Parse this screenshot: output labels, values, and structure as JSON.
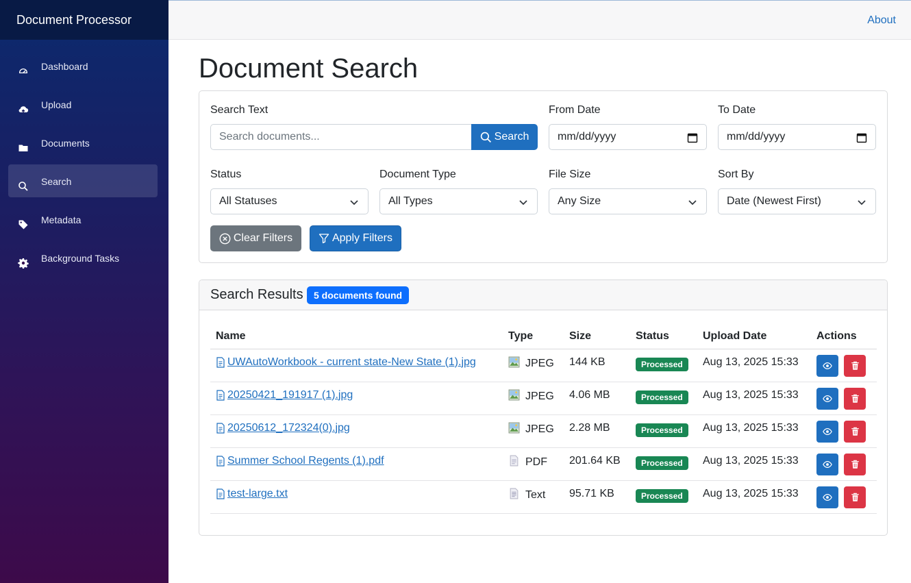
{
  "app": {
    "brand": "Document Processor"
  },
  "sidebar": {
    "items": [
      {
        "label": "Dashboard",
        "icon": "speedometer-icon",
        "active": false
      },
      {
        "label": "Upload",
        "icon": "cloud-upload-icon",
        "active": false
      },
      {
        "label": "Documents",
        "icon": "folder-icon",
        "active": false
      },
      {
        "label": "Search",
        "icon": "search-icon",
        "active": true
      },
      {
        "label": "Metadata",
        "icon": "tag-icon",
        "active": false
      },
      {
        "label": "Background Tasks",
        "icon": "gear-icon",
        "active": false
      }
    ]
  },
  "topbar": {
    "about_label": "About"
  },
  "page": {
    "title": "Document Search"
  },
  "filters": {
    "search_text_label": "Search Text",
    "search_placeholder": "Search documents...",
    "search_button": "Search",
    "from_date_label": "From Date",
    "from_date_placeholder": "mm/dd/yyyy",
    "to_date_label": "To Date",
    "to_date_placeholder": "mm/dd/yyyy",
    "status_label": "Status",
    "status_value": "All Statuses",
    "doc_type_label": "Document Type",
    "doc_type_value": "All Types",
    "file_size_label": "File Size",
    "file_size_value": "Any Size",
    "sort_by_label": "Sort By",
    "sort_by_value": "Date (Newest First)",
    "clear_button": "Clear Filters",
    "apply_button": "Apply Filters"
  },
  "results": {
    "title": "Search Results",
    "count_badge": "5 documents found",
    "columns": [
      "Name",
      "Type",
      "Size",
      "Status",
      "Upload Date",
      "Actions"
    ],
    "rows": [
      {
        "name": "UWAutoWorkbook - current state-New State (1).jpg",
        "type": "JPEG",
        "type_icon": "image-icon",
        "size": "144 KB",
        "status": "Processed",
        "upload_date": "Aug 13, 2025 15:33"
      },
      {
        "name": "20250421_191917 (1).jpg",
        "type": "JPEG",
        "type_icon": "image-icon",
        "size": "4.06 MB",
        "status": "Processed",
        "upload_date": "Aug 13, 2025 15:33"
      },
      {
        "name": "20250612_172324(0).jpg",
        "type": "JPEG",
        "type_icon": "image-icon",
        "size": "2.28 MB",
        "status": "Processed",
        "upload_date": "Aug 13, 2025 15:33"
      },
      {
        "name": "Summer School Regents (1).pdf",
        "type": "PDF",
        "type_icon": "pdf-file-icon",
        "size": "201.64 KB",
        "status": "Processed",
        "upload_date": "Aug 13, 2025 15:33"
      },
      {
        "name": "test-large.txt",
        "type": "Text",
        "type_icon": "text-file-icon",
        "size": "95.71 KB",
        "status": "Processed",
        "upload_date": "Aug 13, 2025 15:33"
      }
    ]
  },
  "colors": {
    "primary": "#1f6fbf",
    "secondary": "#6c757d",
    "success": "#198754",
    "danger": "#dc3545",
    "badge": "#0d6efd"
  }
}
